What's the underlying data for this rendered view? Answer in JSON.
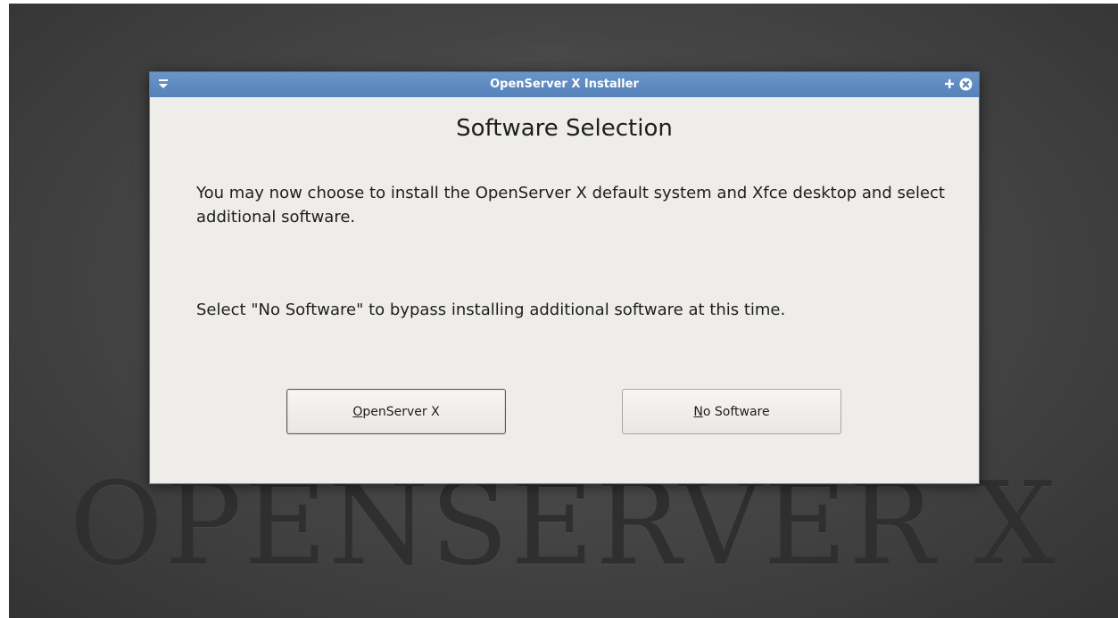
{
  "wallpaper": {
    "logo_text": "OPENSERVER X"
  },
  "window": {
    "title": "OpenServer X Installer",
    "titlebar_color": "#5a86bd",
    "icons": {
      "menu": "window-menu-icon",
      "maximize": "maximize-plus-icon",
      "close": "close-circle-icon"
    }
  },
  "dialog": {
    "heading": "Software Selection",
    "paragraph_1": "You may now choose to install the OpenServer X default system and Xfce desktop and select additional software.",
    "paragraph_2": "Select \"No Software\" to bypass installing additional software at this time."
  },
  "buttons": {
    "openserver": {
      "mnemonic": "O",
      "label_rest": "penServer X"
    },
    "no_software": {
      "mnemonic": "N",
      "label_rest": "o Software"
    }
  }
}
